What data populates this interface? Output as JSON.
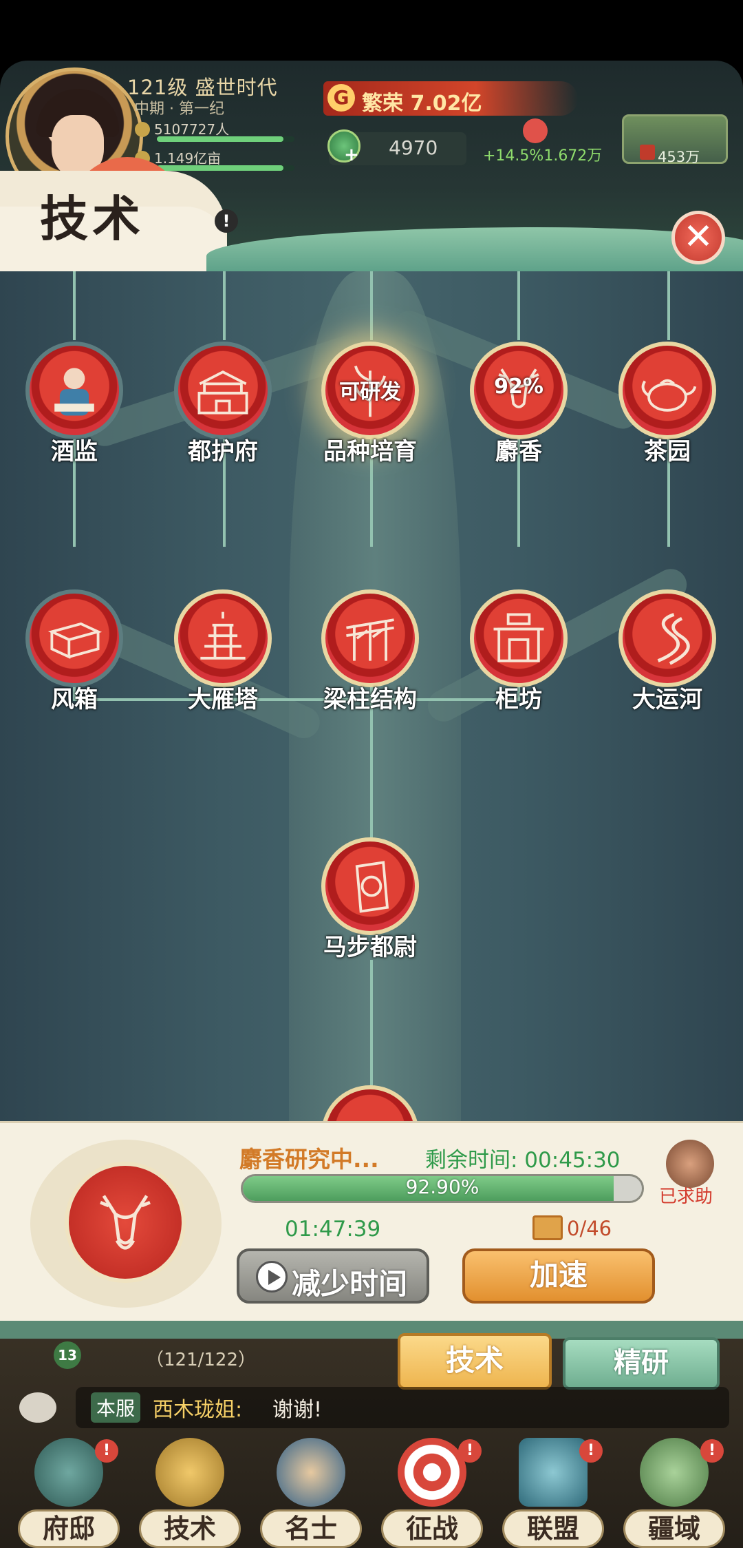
{
  "header": {
    "level_title": "121级 盛世时代",
    "era_sub": "中期 · 第一纪",
    "population": "5107727人",
    "land": "1.149亿亩",
    "prosperity_badge": "G",
    "prosperity": "繁荣 7.02亿",
    "coin_value": "4970",
    "rate": "+14.5%1.672万",
    "land_card_value": "453万",
    "page_title": "技术",
    "alert": "!",
    "close": "✕"
  },
  "tree": {
    "row1": [
      {
        "label": "酒监",
        "icon": "scholar-icon",
        "state": "done"
      },
      {
        "label": "都护府",
        "icon": "gate-tower-icon",
        "state": "done"
      },
      {
        "label": "品种培育",
        "icon": "grain-icon",
        "state": "available",
        "overlay": "可研发"
      },
      {
        "label": "麝香",
        "icon": "deer-icon",
        "state": "researching",
        "overlay": "92%"
      },
      {
        "label": "茶园",
        "icon": "teapot-icon",
        "state": "locked"
      }
    ],
    "row2": [
      {
        "label": "风箱",
        "icon": "bellows-icon",
        "state": "done"
      },
      {
        "label": "大雁塔",
        "icon": "pagoda-icon",
        "state": "locked"
      },
      {
        "label": "梁柱结构",
        "icon": "beam-icon",
        "state": "locked"
      },
      {
        "label": "柜坊",
        "icon": "shop-icon",
        "state": "locked"
      },
      {
        "label": "大运河",
        "icon": "canal-icon",
        "state": "locked"
      }
    ],
    "row3": [
      {
        "label": "马步都尉",
        "icon": "token-icon",
        "state": "locked"
      }
    ]
  },
  "panel": {
    "research_name": "麝香研究中...",
    "remaining": "剩余时间: 00:45:30",
    "progress_text": "92.90%",
    "progress": 0.929,
    "helper": "已求助",
    "timer2": "01:47:39",
    "ticket_count": "0/46",
    "reduce_label": "减少时间",
    "speed_label": "加速"
  },
  "bottom": {
    "level_badge": "13",
    "progress_count": "（121/122）",
    "tab_tech": "技术",
    "tab_study": "精研",
    "chat_server": "本服",
    "chat_name": "西木珑姐:",
    "chat_msg": "谢谢!",
    "nav": [
      {
        "label": "府邸",
        "icon": "mansion-icon",
        "badge": "!"
      },
      {
        "label": "技术",
        "icon": "wheat-icon",
        "badge": ""
      },
      {
        "label": "名士",
        "icon": "sage-icon",
        "badge": ""
      },
      {
        "label": "征战",
        "icon": "target-icon",
        "badge": "!"
      },
      {
        "label": "联盟",
        "icon": "banner-icon",
        "badge": "!"
      },
      {
        "label": "疆域",
        "icon": "mountain-icon",
        "badge": "!"
      }
    ]
  },
  "colors": {
    "accent_red": "#d7343a",
    "gold": "#e9d7a3",
    "progress_green": "#4d9d5d"
  }
}
